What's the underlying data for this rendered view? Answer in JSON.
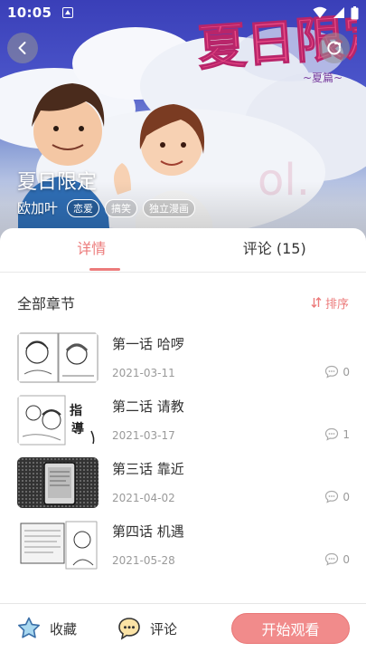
{
  "status_bar": {
    "time": "10:05"
  },
  "hero": {
    "title": "夏日限定",
    "author": "欧加叶",
    "tags": [
      "恋爱",
      "搞笑",
      "独立漫画"
    ],
    "logo_text": "夏日限定",
    "logo_sub": "~夏篇~"
  },
  "tabs": [
    {
      "label": "详情",
      "active": true
    },
    {
      "label": "评论  (15)",
      "active": false
    }
  ],
  "chapters_section": {
    "title": "全部章节",
    "sort_label": "排序"
  },
  "chapters": [
    {
      "title": "第一话 哈啰",
      "date": "2021-03-11",
      "comments": "0"
    },
    {
      "title": "第二话 请教",
      "date": "2021-03-17",
      "comments": "1"
    },
    {
      "title": "第三话 靠近",
      "date": "2021-04-02",
      "comments": "0"
    },
    {
      "title": "第四话 机遇",
      "date": "2021-05-28",
      "comments": "0"
    }
  ],
  "bottom_bar": {
    "favorite_label": "收藏",
    "comment_label": "评论",
    "start_label": "开始观看"
  },
  "colors": {
    "accent": "#ec7b7b",
    "button": "#f18b8b",
    "hero_sky": "#3a3fb8"
  }
}
